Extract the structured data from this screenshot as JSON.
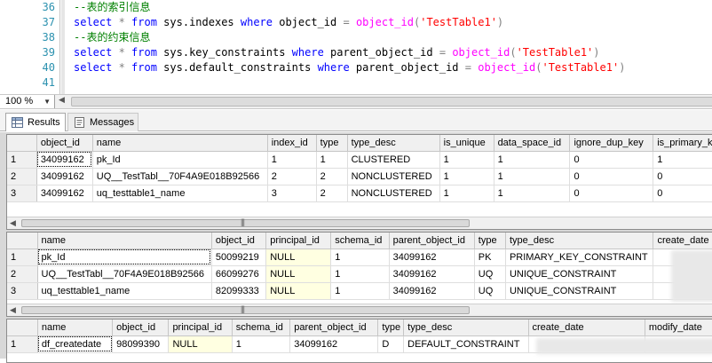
{
  "editor": {
    "lines": [
      {
        "number": "36",
        "segments": [
          {
            "t": "--表的索引信息",
            "c": "cm"
          }
        ]
      },
      {
        "number": "37",
        "segments": [
          {
            "t": "select",
            "c": "kw"
          },
          {
            "t": " * ",
            "c": "op"
          },
          {
            "t": "from",
            "c": "kw"
          },
          {
            "t": " sys.indexes ",
            "c": ""
          },
          {
            "t": "where",
            "c": "kw"
          },
          {
            "t": " object_id ",
            "c": ""
          },
          {
            "t": "=",
            "c": "op"
          },
          {
            "t": " ",
            "c": ""
          },
          {
            "t": "object_id",
            "c": "fn"
          },
          {
            "t": "(",
            "c": "op"
          },
          {
            "t": "'TestTable1'",
            "c": "str"
          },
          {
            "t": ")",
            "c": "op"
          }
        ]
      },
      {
        "number": "38",
        "segments": [
          {
            "t": "--表的约束信息",
            "c": "cm"
          }
        ]
      },
      {
        "number": "39",
        "segments": [
          {
            "t": "select",
            "c": "kw"
          },
          {
            "t": " * ",
            "c": "op"
          },
          {
            "t": "from",
            "c": "kw"
          },
          {
            "t": " sys.key_constraints ",
            "c": ""
          },
          {
            "t": "where",
            "c": "kw"
          },
          {
            "t": " parent_object_id ",
            "c": ""
          },
          {
            "t": "=",
            "c": "op"
          },
          {
            "t": " ",
            "c": ""
          },
          {
            "t": "object_id",
            "c": "fn"
          },
          {
            "t": "(",
            "c": "op"
          },
          {
            "t": "'TestTable1'",
            "c": "str"
          },
          {
            "t": ")",
            "c": "op"
          }
        ]
      },
      {
        "number": "40",
        "segments": [
          {
            "t": "select",
            "c": "kw"
          },
          {
            "t": " * ",
            "c": "op"
          },
          {
            "t": "from",
            "c": "kw"
          },
          {
            "t": " sys.default_constraints ",
            "c": ""
          },
          {
            "t": "where",
            "c": "kw"
          },
          {
            "t": " parent_object_id ",
            "c": ""
          },
          {
            "t": "=",
            "c": "op"
          },
          {
            "t": " ",
            "c": ""
          },
          {
            "t": "object_id",
            "c": "fn"
          },
          {
            "t": "(",
            "c": "op"
          },
          {
            "t": "'TestTable1'",
            "c": "str"
          },
          {
            "t": ")",
            "c": "op"
          }
        ]
      },
      {
        "number": "41",
        "segments": []
      }
    ]
  },
  "zoom": {
    "value": "100 %"
  },
  "tabs": {
    "results": "Results",
    "messages": "Messages"
  },
  "grids": [
    {
      "columns": [
        "",
        "object_id",
        "name",
        "index_id",
        "type",
        "type_desc",
        "is_unique",
        "data_space_id",
        "ignore_dup_key",
        "is_primary_k"
      ],
      "rows": [
        [
          "1",
          "34099162",
          "pk_Id",
          "1",
          "1",
          "CLUSTERED",
          "1",
          "1",
          "0",
          "1"
        ],
        [
          "2",
          "34099162",
          "UQ__TestTabl__70F4A9E018B92566",
          "2",
          "2",
          "NONCLUSTERED",
          "1",
          "1",
          "0",
          "0"
        ],
        [
          "3",
          "34099162",
          "uq_testtable1_name",
          "3",
          "2",
          "NONCLUSTERED",
          "1",
          "1",
          "0",
          "0"
        ]
      ]
    },
    {
      "columns": [
        "",
        "name",
        "object_id",
        "principal_id",
        "schema_id",
        "parent_object_id",
        "type",
        "type_desc",
        "create_date"
      ],
      "rows": [
        [
          "1",
          "pk_Id",
          "50099219",
          "NULL",
          "1",
          "34099162",
          "PK",
          "PRIMARY_KEY_CONSTRAINT",
          ""
        ],
        [
          "2",
          "UQ__TestTabl__70F4A9E018B92566",
          "66099276",
          "NULL",
          "1",
          "34099162",
          "UQ",
          "UNIQUE_CONSTRAINT",
          ""
        ],
        [
          "3",
          "uq_testtable1_name",
          "82099333",
          "NULL",
          "1",
          "34099162",
          "UQ",
          "UNIQUE_CONSTRAINT",
          ""
        ]
      ]
    },
    {
      "columns": [
        "",
        "name",
        "object_id",
        "principal_id",
        "schema_id",
        "parent_object_id",
        "type",
        "type_desc",
        "create_date",
        "modify_date"
      ],
      "rows": [
        [
          "1",
          "df_createdate",
          "98099390",
          "NULL",
          "1",
          "34099162",
          "D",
          "DEFAULT_CONSTRAINT",
          "",
          ""
        ]
      ]
    }
  ]
}
